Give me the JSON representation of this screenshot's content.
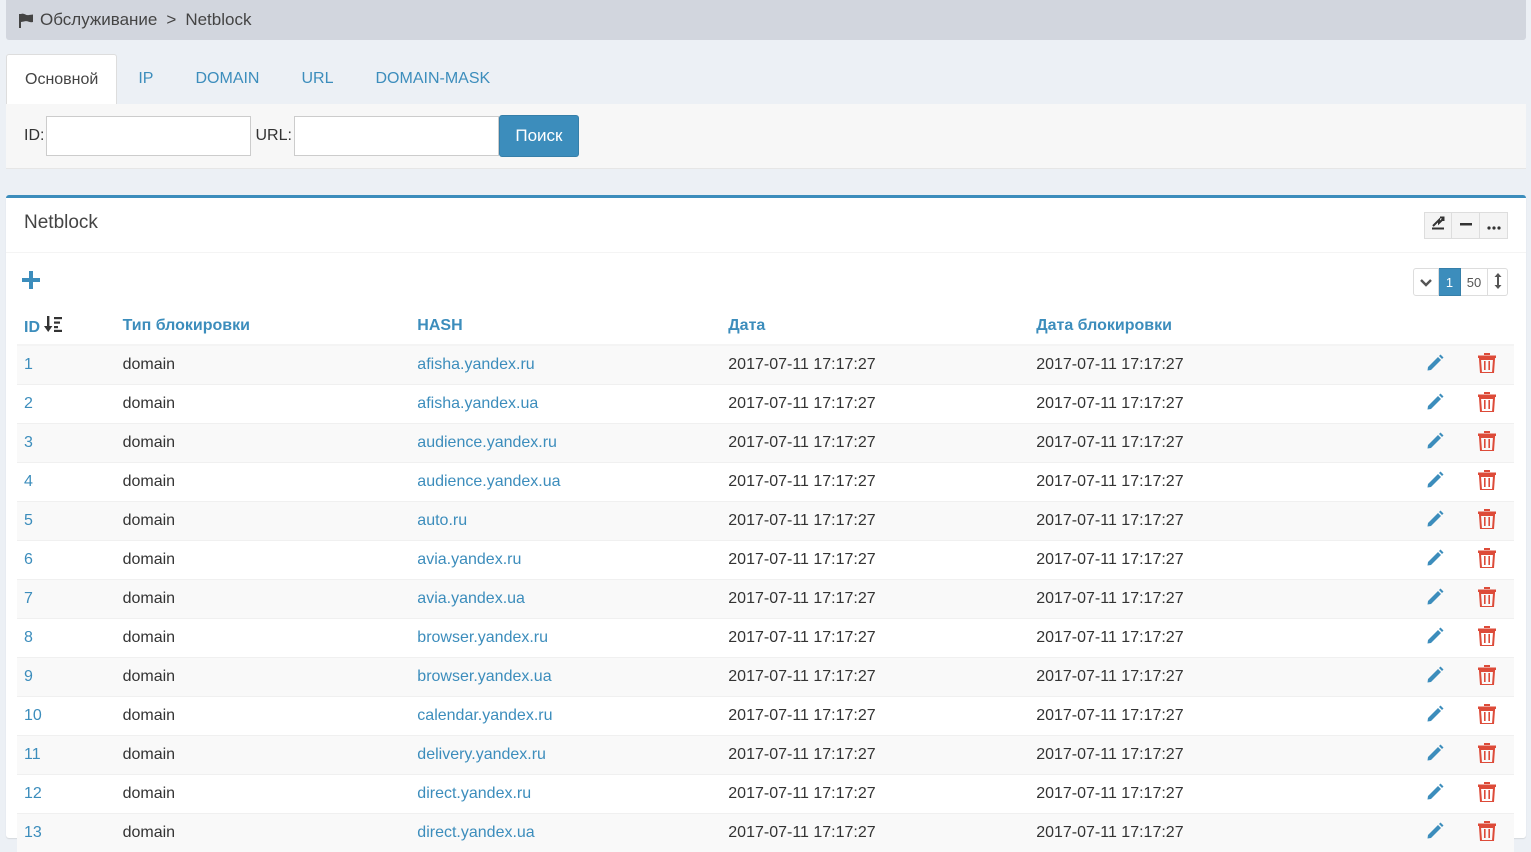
{
  "breadcrumb": {
    "section": "Обслуживание",
    "separator": ">",
    "current": "Netblock"
  },
  "tabs": [
    "Основной",
    "IP",
    "DOMAIN",
    "URL",
    "DOMAIN-MASK"
  ],
  "search": {
    "id_label": "ID:",
    "id_value": "",
    "url_label": "URL:",
    "url_value": "",
    "button": "Поиск"
  },
  "box": {
    "title": "Netblock"
  },
  "pager": {
    "page": "1",
    "size": "50"
  },
  "table": {
    "headers": {
      "id": "ID",
      "type": "Тип блокировки",
      "hash": "HASH",
      "date": "Дата",
      "block_date": "Дата блокировки"
    },
    "rows": [
      {
        "id": "1",
        "type": "domain",
        "hash": "afisha.yandex.ru",
        "date": "2017-07-11 17:17:27",
        "block_date": "2017-07-11 17:17:27"
      },
      {
        "id": "2",
        "type": "domain",
        "hash": "afisha.yandex.ua",
        "date": "2017-07-11 17:17:27",
        "block_date": "2017-07-11 17:17:27"
      },
      {
        "id": "3",
        "type": "domain",
        "hash": "audience.yandex.ru",
        "date": "2017-07-11 17:17:27",
        "block_date": "2017-07-11 17:17:27"
      },
      {
        "id": "4",
        "type": "domain",
        "hash": "audience.yandex.ua",
        "date": "2017-07-11 17:17:27",
        "block_date": "2017-07-11 17:17:27"
      },
      {
        "id": "5",
        "type": "domain",
        "hash": "auto.ru",
        "date": "2017-07-11 17:17:27",
        "block_date": "2017-07-11 17:17:27"
      },
      {
        "id": "6",
        "type": "domain",
        "hash": "avia.yandex.ru",
        "date": "2017-07-11 17:17:27",
        "block_date": "2017-07-11 17:17:27"
      },
      {
        "id": "7",
        "type": "domain",
        "hash": "avia.yandex.ua",
        "date": "2017-07-11 17:17:27",
        "block_date": "2017-07-11 17:17:27"
      },
      {
        "id": "8",
        "type": "domain",
        "hash": "browser.yandex.ru",
        "date": "2017-07-11 17:17:27",
        "block_date": "2017-07-11 17:17:27"
      },
      {
        "id": "9",
        "type": "domain",
        "hash": "browser.yandex.ua",
        "date": "2017-07-11 17:17:27",
        "block_date": "2017-07-11 17:17:27"
      },
      {
        "id": "10",
        "type": "domain",
        "hash": "calendar.yandex.ru",
        "date": "2017-07-11 17:17:27",
        "block_date": "2017-07-11 17:17:27"
      },
      {
        "id": "11",
        "type": "domain",
        "hash": "delivery.yandex.ru",
        "date": "2017-07-11 17:17:27",
        "block_date": "2017-07-11 17:17:27"
      },
      {
        "id": "12",
        "type": "domain",
        "hash": "direct.yandex.ru",
        "date": "2017-07-11 17:17:27",
        "block_date": "2017-07-11 17:17:27"
      },
      {
        "id": "13",
        "type": "domain",
        "hash": "direct.yandex.ua",
        "date": "2017-07-11 17:17:27",
        "block_date": "2017-07-11 17:17:27"
      }
    ]
  },
  "colors": {
    "accent": "#3c8dbc",
    "danger": "#dd4b39",
    "breadcrumb_bg": "#d2d6de",
    "page_bg": "#ecf0f5"
  }
}
